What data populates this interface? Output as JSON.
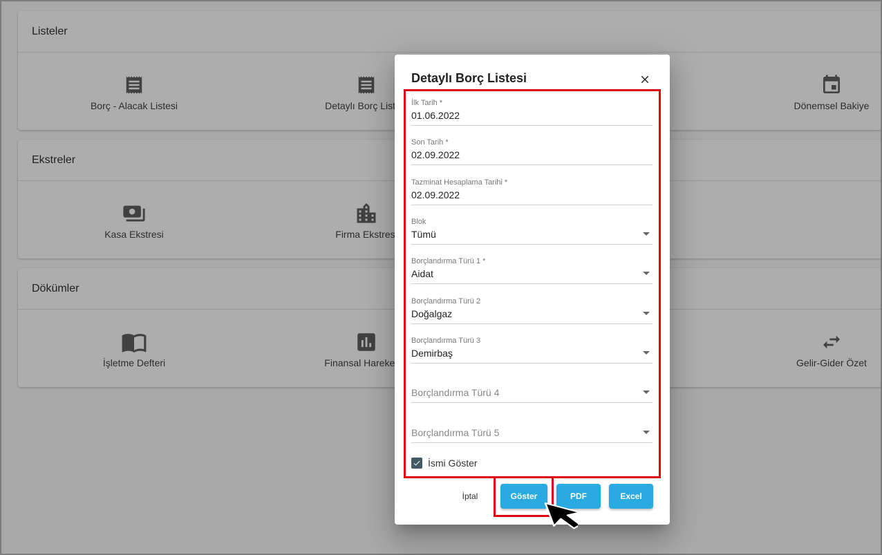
{
  "sections": [
    {
      "title": "Listeler",
      "tiles": [
        {
          "label": "Borç - Alacak Listesi",
          "icon": "receipt-icon"
        },
        {
          "label": "Detaylı Borç Listesi",
          "icon": "receipt-list-icon"
        },
        {
          "label": "Dönemsel Bakiye",
          "icon": "calendar-icon"
        }
      ]
    },
    {
      "title": "Ekstreler",
      "tiles": [
        {
          "label": "Kasa Ekstresi",
          "icon": "cash-icon"
        },
        {
          "label": "Firma Ekstresi",
          "icon": "building-icon"
        }
      ]
    },
    {
      "title": "Dökümler",
      "tiles": [
        {
          "label": "İşletme Defteri",
          "icon": "book-icon"
        },
        {
          "label": "Finansal Hareketler",
          "icon": "bar-chart-icon"
        },
        {
          "label": "Gelir-Gider Özet",
          "icon": "swap-icon"
        }
      ]
    }
  ],
  "dialog": {
    "title": "Detaylı Borç Listesi",
    "fields": [
      {
        "label": "İlk Tarih *",
        "value": "01.06.2022"
      },
      {
        "label": "Son Tarih *",
        "value": "02.09.2022"
      },
      {
        "label": "Tazminat Hesaplama Tarihi *",
        "value": "02.09.2022"
      },
      {
        "label": "Blok",
        "value": "Tümü"
      },
      {
        "label": "Borçlandırma Türü 1 *",
        "value": "Aidat"
      },
      {
        "label": "Borçlandırma Türü 2",
        "value": "Doğalgaz"
      },
      {
        "label": "Borçlandırma Türü 3",
        "value": "Demirbaş"
      },
      {
        "placeholder": "Borçlandırma Türü 4"
      },
      {
        "placeholder": "Borçlandırma Türü 5"
      }
    ],
    "checkbox": {
      "label": "İsmi Göster",
      "checked": true
    },
    "buttons": {
      "cancel": "İptal",
      "show": "Göster",
      "pdf": "PDF",
      "excel": "Excel"
    }
  },
  "colors": {
    "primary_button": "#29abe2",
    "highlight": "#e30613",
    "checkbox": "#455a64"
  }
}
